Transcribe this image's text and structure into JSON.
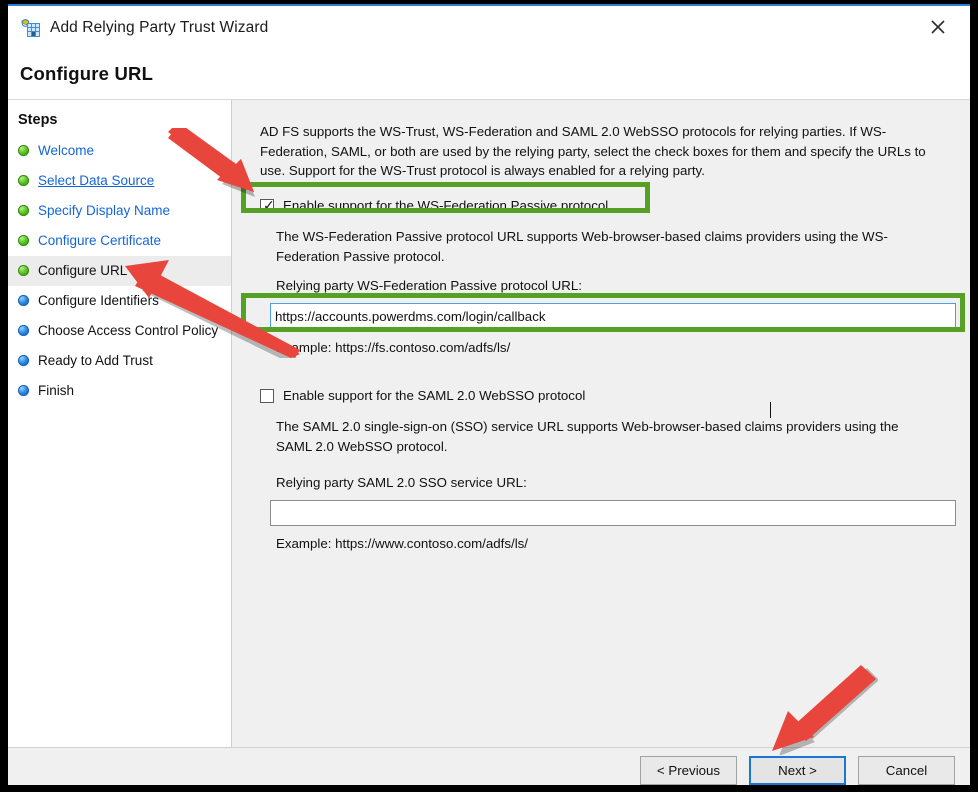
{
  "window": {
    "title": "Add Relying Party Trust Wizard",
    "icon": "adfs-relying-party-icon",
    "close_label": "×",
    "page_heading": "Configure URL"
  },
  "sidebar": {
    "heading": "Steps",
    "items": [
      {
        "label": "Welcome",
        "state": "done",
        "style": "plain"
      },
      {
        "label": "Select Data Source",
        "state": "done",
        "style": "link"
      },
      {
        "label": "Specify Display Name",
        "state": "done",
        "style": "plain"
      },
      {
        "label": "Configure Certificate",
        "state": "done",
        "style": "plain"
      },
      {
        "label": "Configure URL",
        "state": "current",
        "style": "plain"
      },
      {
        "label": "Configure Identifiers",
        "state": "pending",
        "style": "plain"
      },
      {
        "label": "Choose Access Control Policy",
        "state": "pending",
        "style": "plain"
      },
      {
        "label": "Ready to Add Trust",
        "state": "pending",
        "style": "plain"
      },
      {
        "label": "Finish",
        "state": "pending",
        "style": "plain"
      }
    ]
  },
  "main": {
    "intro": "AD FS supports the WS-Trust, WS-Federation and SAML 2.0 WebSSO protocols for relying parties.  If WS-Federation, SAML, or both are used by the relying party, select the check boxes for them and specify the URLs to use.  Support for the WS-Trust protocol is always enabled for a relying party.",
    "wsfed": {
      "checkbox_label": "Enable support for the WS-Federation Passive protocol",
      "checked": true,
      "description": "The WS-Federation Passive protocol URL supports Web-browser-based claims providers using the WS-Federation Passive protocol.",
      "url_label": "Relying party WS-Federation Passive protocol URL:",
      "url_value": "https://accounts.powerdms.com/login/callback",
      "url_placeholder": "",
      "example": "Example: https://fs.contoso.com/adfs/ls/"
    },
    "saml": {
      "checkbox_label": "Enable support for the SAML 2.0 WebSSO protocol",
      "checked": false,
      "description": "The SAML 2.0 single-sign-on (SSO) service URL supports Web-browser-based claims providers using the SAML 2.0 WebSSO protocol.",
      "url_label": "Relying party SAML 2.0 SSO service URL:",
      "url_value": "",
      "url_placeholder": "",
      "example": "Example: https://www.contoso.com/adfs/ls/"
    }
  },
  "footer": {
    "previous_label": "< Previous",
    "next_label": "Next >",
    "cancel_label": "Cancel"
  },
  "annotations": {
    "highlight_color": "#56a026",
    "arrow_color": "#e8453c",
    "arrows": [
      {
        "name": "arrow-to-wsfed-checkbox",
        "points_to": "wsfed-checkbox"
      },
      {
        "name": "arrow-to-configure-url-step",
        "points_to": "sidebar-item-configure-url"
      },
      {
        "name": "arrow-to-next-button",
        "points_to": "next-button"
      }
    ],
    "boxes": [
      {
        "name": "highlight-wsfed-checkbox"
      },
      {
        "name": "highlight-wsfed-url-input"
      }
    ]
  }
}
